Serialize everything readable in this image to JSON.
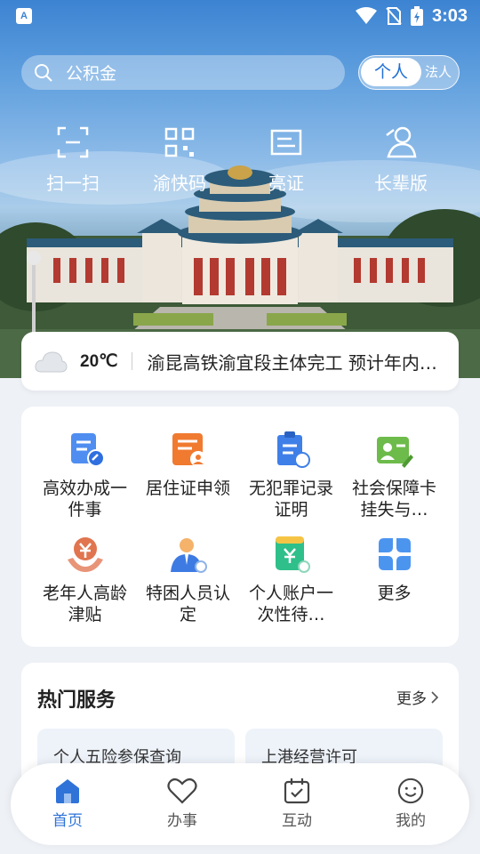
{
  "status": {
    "time": "3:03"
  },
  "search": {
    "placeholder": "公积金"
  },
  "toggle": {
    "active": "个人",
    "other": "法人"
  },
  "quick_actions": [
    {
      "label": "扫一扫",
      "icon": "scan-icon"
    },
    {
      "label": "渝快码",
      "icon": "qr-code-icon"
    },
    {
      "label": "亮证",
      "icon": "id-card-icon"
    },
    {
      "label": "长辈版",
      "icon": "elder-mode-icon"
    }
  ],
  "weather": {
    "temp": "20℃",
    "icon": "cloud-icon"
  },
  "news": {
    "headline": "渝昆高铁渝宜段主体完工 预计年内…"
  },
  "services": [
    {
      "label": "高效办成一件事",
      "icon": "efficient-service-icon"
    },
    {
      "label": "居住证申领",
      "icon": "residence-permit-icon"
    },
    {
      "label": "无犯罪记录证明",
      "icon": "no-criminal-record-icon"
    },
    {
      "label": "社会保障卡挂失与…",
      "icon": "social-security-card-icon"
    },
    {
      "label": "老年人高龄津贴",
      "icon": "elderly-allowance-icon"
    },
    {
      "label": "特困人员认定",
      "icon": "poverty-certification-icon"
    },
    {
      "label": "个人账户一次性待…",
      "icon": "personal-account-icon"
    },
    {
      "label": "更多",
      "icon": "more-grid-icon"
    }
  ],
  "hot": {
    "title": "热门服务",
    "more": "更多",
    "cards": [
      "个人五险参保查询",
      "上港经营许可"
    ]
  },
  "nav": [
    {
      "label": "首页",
      "icon": "home-icon",
      "active": true
    },
    {
      "label": "办事",
      "icon": "heart-icon",
      "active": false
    },
    {
      "label": "互动",
      "icon": "calendar-check-icon",
      "active": false
    },
    {
      "label": "我的",
      "icon": "smile-icon",
      "active": false
    }
  ],
  "colors": {
    "accent": "#2f73d8",
    "background": "#eef1f6"
  }
}
